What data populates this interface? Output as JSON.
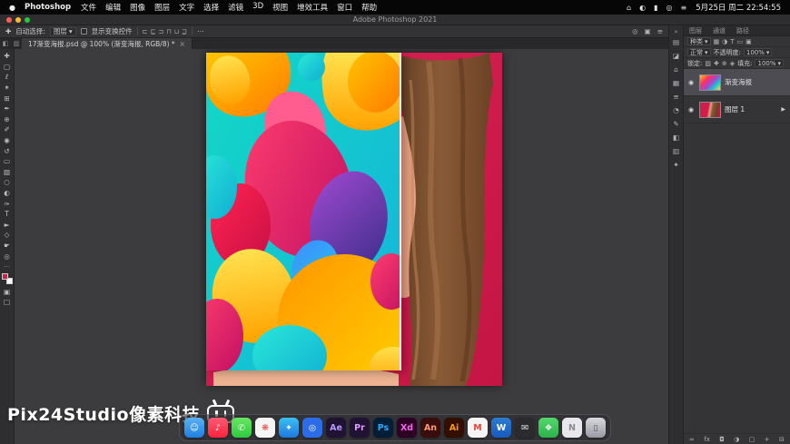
{
  "menubar": {
    "apple_icon": "●",
    "app_name": "Photoshop",
    "menus": [
      "文件",
      "编辑",
      "图像",
      "图层",
      "文字",
      "选择",
      "滤镜",
      "3D",
      "视图",
      "增效工具",
      "窗口",
      "帮助"
    ],
    "status_icons": [
      {
        "glyph": "⌂",
        "name": "input-source-icon"
      },
      {
        "glyph": "◐",
        "name": "display-icon"
      },
      {
        "glyph": "▮",
        "name": "battery-icon"
      },
      {
        "glyph": "◎",
        "name": "spotlight-icon"
      },
      {
        "glyph": "≡",
        "name": "control-center-icon"
      }
    ],
    "clock": "5月25日 周二 22:54:55"
  },
  "window": {
    "title": "Adobe Photoshop 2021"
  },
  "options_bar": {
    "tool_icon": "✚",
    "auto_select_label": "自动选择:",
    "auto_select_value": "图层",
    "dropdown_caret": "▾",
    "show_transform_label": "显示变换控件",
    "align_icons": [
      "⊏",
      "⊑",
      "⊐",
      "⊓",
      "⊔",
      "⊒"
    ],
    "overflow_icon": "⋯",
    "right_icons": [
      {
        "glyph": "◎",
        "name": "search-icon"
      },
      {
        "glyph": "▣",
        "name": "workspace-switcher-icon"
      },
      {
        "glyph": "≡",
        "name": "arrange-icon"
      }
    ]
  },
  "tab_bar": {
    "left_icons": [
      {
        "glyph": "◧",
        "name": "workspace-toggle-icon"
      },
      {
        "glyph": "▥",
        "name": "panel-toggle-icon"
      }
    ],
    "doc_title": "17渐变海报.psd @ 100% (渐变海报, RGB/8) *",
    "close_icon": "×"
  },
  "toolbar": {
    "tools": [
      {
        "glyph": "✚",
        "name": "move-tool"
      },
      {
        "glyph": "▢",
        "name": "marquee-tool"
      },
      {
        "glyph": "ℓ",
        "name": "lasso-tool"
      },
      {
        "glyph": "✶",
        "name": "magic-wand-tool"
      },
      {
        "glyph": "⊞",
        "name": "crop-tool"
      },
      {
        "glyph": "✒",
        "name": "eyedropper-tool"
      },
      {
        "glyph": "⊕",
        "name": "healing-brush-tool"
      },
      {
        "glyph": "✐",
        "name": "brush-tool"
      },
      {
        "glyph": "◉",
        "name": "clone-stamp-tool"
      },
      {
        "glyph": "↺",
        "name": "history-brush-tool"
      },
      {
        "glyph": "▭",
        "name": "eraser-tool"
      },
      {
        "glyph": "▧",
        "name": "gradient-tool"
      },
      {
        "glyph": "○",
        "name": "blur-tool"
      },
      {
        "glyph": "◐",
        "name": "dodge-tool"
      },
      {
        "glyph": "✑",
        "name": "pen-tool"
      },
      {
        "glyph": "T",
        "name": "type-tool"
      },
      {
        "glyph": "►",
        "name": "path-select-tool"
      },
      {
        "glyph": "◇",
        "name": "shape-tool"
      },
      {
        "glyph": "☛",
        "name": "hand-tool"
      },
      {
        "glyph": "◎",
        "name": "zoom-tool"
      }
    ],
    "more_icon": "⋯",
    "fg_color": "#d21c4c",
    "bg_color": "#ffffff",
    "bottom_tools": [
      {
        "glyph": "▣",
        "name": "quick-mask-button"
      },
      {
        "glyph": "□",
        "name": "screen-mode-button"
      }
    ]
  },
  "panels_strip": {
    "collapse_icon": "»",
    "icons": [
      {
        "glyph": "▤",
        "name": "properties-panel-icon"
      },
      {
        "glyph": "◪",
        "name": "adjustments-panel-icon"
      },
      {
        "glyph": "⌂",
        "name": "libraries-panel-icon"
      },
      {
        "glyph": "▦",
        "name": "color-panel-icon"
      },
      {
        "glyph": "≡",
        "name": "swatches-panel-icon"
      },
      {
        "glyph": "◔",
        "name": "history-panel-icon"
      },
      {
        "glyph": "✎",
        "name": "brushes-panel-icon"
      },
      {
        "glyph": "◧",
        "name": "patterns-panel-icon"
      },
      {
        "glyph": "▥",
        "name": "gradients-panel-icon"
      },
      {
        "glyph": "✦",
        "name": "styles-panel-icon"
      }
    ]
  },
  "layers_panel": {
    "tabs": [
      "图层",
      "通道",
      "路径"
    ],
    "filter_label": "种类",
    "caret": "▾",
    "filter_icons": [
      {
        "glyph": "▦",
        "name": "filter-pixel-layers-icon"
      },
      {
        "glyph": "◑",
        "name": "filter-adjustment-layers-icon"
      },
      {
        "glyph": "T",
        "name": "filter-type-layers-icon"
      },
      {
        "glyph": "▭",
        "name": "filter-shape-layers-icon"
      },
      {
        "glyph": "▣",
        "name": "filter-smart-objects-icon"
      }
    ],
    "blend_mode": "正常",
    "opacity_label": "不透明度:",
    "opacity_value": "100%",
    "lock_label": "锁定:",
    "lock_icons": [
      {
        "glyph": "▨",
        "name": "lock-transparency-icon"
      },
      {
        "glyph": "✚",
        "name": "lock-position-icon"
      },
      {
        "glyph": "⊕",
        "name": "lock-image-icon"
      },
      {
        "glyph": "◈",
        "name": "lock-all-icon"
      }
    ],
    "fill_label": "填充:",
    "fill_value": "100%",
    "layers": [
      {
        "name": "渐变海报",
        "selected": true,
        "eye": "◉",
        "extra": "",
        "thumb": "linear-gradient(135deg,#ffc400 0%,#ff2e63 30%,#a04ad0 55%,#14c8d4 75%,#ffd84d 100%)"
      },
      {
        "name": "图层 1",
        "selected": false,
        "eye": "◉",
        "extra": "▶",
        "thumb": "linear-gradient(100deg,#d21c4c 40%,#e8a183 50%,#8a5a36 60%,#6b4226 80%,#c41544 95%)"
      }
    ],
    "bottom_icons": [
      {
        "glyph": "∞",
        "name": "link-layers-button"
      },
      {
        "glyph": "fx",
        "name": "layer-style-button"
      },
      {
        "glyph": "◘",
        "name": "add-layer-mask-button"
      },
      {
        "glyph": "◑",
        "name": "new-adjustment-layer-button"
      },
      {
        "glyph": "▢",
        "name": "new-group-button"
      },
      {
        "glyph": "+",
        "name": "new-layer-button"
      },
      {
        "glyph": "⊟",
        "name": "delete-layer-button"
      }
    ]
  },
  "dock": {
    "apps": [
      {
        "label": "☺",
        "name": "dock-finder",
        "bg": "linear-gradient(180deg,#5ab2f2,#1e7fe0)",
        "fg": "#ffffff"
      },
      {
        "label": "♪",
        "name": "dock-music",
        "bg": "linear-gradient(180deg,#fb5c74,#fa233b)",
        "fg": "#ffffff"
      },
      {
        "label": "✆",
        "name": "dock-facetime",
        "bg": "linear-gradient(180deg,#67e860,#2ec940)",
        "fg": "#ffffff"
      },
      {
        "label": "❋",
        "name": "dock-photos",
        "bg": "#f5f5f5",
        "fg": "#e8453c"
      },
      {
        "label": "✦",
        "name": "dock-safari",
        "bg": "linear-gradient(180deg,#3bc0f0,#1f78e0)",
        "fg": "#ffffff"
      },
      {
        "label": "◎",
        "name": "dock-app-store",
        "bg": "#2b6de8",
        "fg": "#ffffff"
      },
      {
        "label": "Ae",
        "name": "dock-after-effects",
        "bg": "#1f1233",
        "fg": "#b49aff"
      },
      {
        "label": "Pr",
        "name": "dock-premiere",
        "bg": "#1f1233",
        "fg": "#e09aff"
      },
      {
        "label": "Ps",
        "name": "dock-photoshop",
        "bg": "#001e36",
        "fg": "#31a8ff"
      },
      {
        "label": "Xd",
        "name": "dock-xd",
        "bg": "#2e0026",
        "fg": "#ff61f6"
      },
      {
        "label": "An",
        "name": "dock-animate",
        "bg": "#3a0d0d",
        "fg": "#ff9a66"
      },
      {
        "label": "Ai",
        "name": "dock-illustrator",
        "bg": "#330f00",
        "fg": "#ff9a00"
      },
      {
        "label": "M",
        "name": "dock-mail",
        "bg": "#f5f5f5",
        "fg": "#ea4335"
      },
      {
        "label": "W",
        "name": "dock-word",
        "bg": "linear-gradient(180deg,#2b7cd3,#185abd)",
        "fg": "#ffffff"
      },
      {
        "label": "✉",
        "name": "dock-messages",
        "bg": "#2b2b2e",
        "fg": "#e8e8e8"
      },
      {
        "label": "❖",
        "name": "dock-wechat",
        "bg": "linear-gradient(180deg,#52d76a,#2bb34a)",
        "fg": "#ffffff"
      },
      {
        "label": "N",
        "name": "dock-notes",
        "bg": "#e8e8ec",
        "fg": "#8a8a92"
      },
      {
        "label": "▯",
        "name": "dock-trash",
        "bg": "linear-gradient(180deg,#d8d8de,#9a9aa4)",
        "fg": "#55555c"
      }
    ]
  },
  "watermark": {
    "text": "Pix24Studio像素科技"
  },
  "artwork_palette": {
    "document_red": "#d21c4c",
    "poster_teal": "#13d8c5",
    "poster_orange": "#ff8a00",
    "poster_yellow": "#ffd84d",
    "poster_magenta": "#ff2e63",
    "poster_purple": "#6a35b0",
    "poster_blue": "#3f8cff",
    "hair_brown": "#7a4a2c",
    "skin": "#e8a183",
    "poster_edge": "#f2ece6"
  }
}
